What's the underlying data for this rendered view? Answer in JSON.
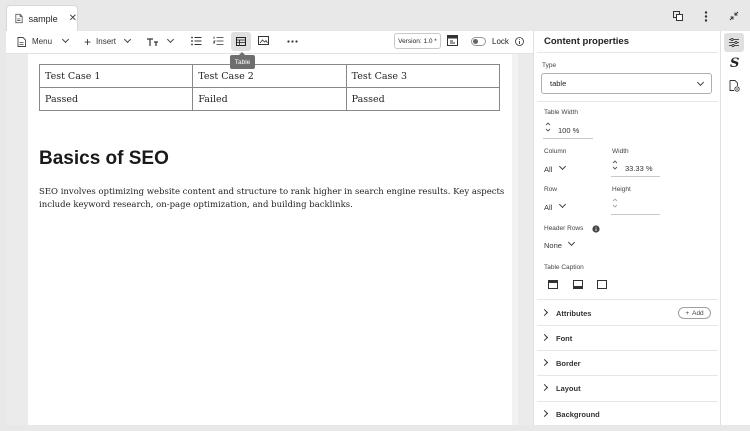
{
  "tab": {
    "title": "sample",
    "close": "✕"
  },
  "toolbar": {
    "menu_label": "Menu",
    "insert_label": "Insert",
    "version_label": "Version: 1.0 *",
    "lock_label": "Lock",
    "tooltip": "Table"
  },
  "document": {
    "table": [
      [
        "Test Case 1",
        "Test Case 2",
        "Test Case 3"
      ],
      [
        "Passed",
        "Failed",
        "Passed"
      ]
    ],
    "heading": "Basics of SEO",
    "paragraph": "SEO involves optimizing website content and structure to rank higher in search engine results. Key aspects include keyword research, on-page optimization, and building backlinks."
  },
  "panel": {
    "title": "Content properties",
    "type_label": "Type",
    "type_value": "table",
    "table_width_label": "Table Width",
    "table_width_value": "100 %",
    "column_label": "Column",
    "column_value": "All",
    "width_label": "Width",
    "width_value": "33.33 %",
    "row_label": "Row",
    "row_value": "All",
    "height_label": "Height",
    "header_rows_label": "Header Rows",
    "header_rows_value": "None",
    "table_caption_label": "Table Caption",
    "sections": [
      {
        "label": "Attributes"
      },
      {
        "label": "Font"
      },
      {
        "label": "Border"
      },
      {
        "label": "Layout"
      },
      {
        "label": "Background"
      }
    ],
    "add_label": "Add"
  },
  "rail": {
    "style_glyph": "S"
  }
}
